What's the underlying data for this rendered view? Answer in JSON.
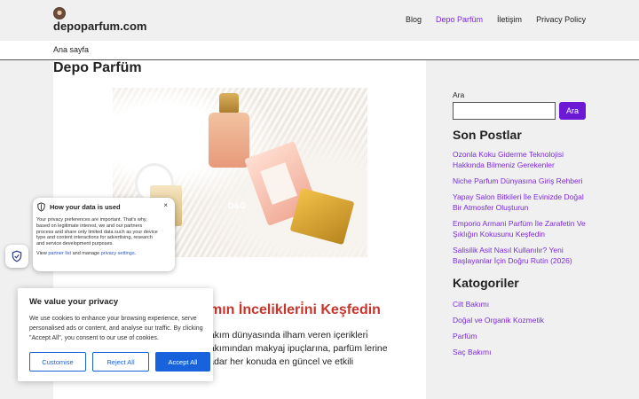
{
  "header": {
    "logo_icon": "perfume-logo-icon",
    "site_title": "depoparfum.com",
    "nav": [
      "Blog",
      "Depo Parfüm",
      "İletişim",
      "Privacy Policy"
    ],
    "active_nav": "Depo Parfüm"
  },
  "breadcrumb": {
    "home": "Ana sayfa"
  },
  "main": {
    "page_title": "Depo Parfüm",
    "hero_image": "perfume-bottles-on-fur",
    "hero_text": "D&G",
    "article_heading": "mın İncelikleri̇ni Keşfedin",
    "excerpt": "bakım dünyasında ilham veren içerikleri̇ bakımından makyaj ipuçlarına, parfüm lerine kadar her konuda en güncel ve etkili"
  },
  "sidebar": {
    "search_label": "Ara",
    "search_placeholder": "",
    "search_button": "Ara",
    "recent_title": "Son Postlar",
    "recent_posts": [
      "Ozonla Koku Giderme Teknolojisi Hakkında Bilmeniz Gerekenler",
      "Niche Parfum Dünyasına Giriş Rehberi",
      "Yapay Salon Bitkileri İle Evinizde Doğal Bir Atmosfer Oluşturun",
      "Emporio Armani Parfüm İle Zarafetin Ve Şıklığın Kokusunu Keşfedin",
      "Salisilik Asit Nasıl Kullanılır? Yeni Başlayanlar İçin Doğru Rutin (2026)"
    ],
    "categories_title": "Katogoriler",
    "categories": [
      "Cilt Bakımı",
      "Doğal ve Organik Kozmetik",
      "Parfüm",
      "Saç Bakımı"
    ]
  },
  "privacy_popup": {
    "title": "How your data is used",
    "close": "×",
    "text": "Your privacy preferences are important. That's why, based on legitimate interest, we and our partners process and share only limited data such as your device type and content interactions for advertising, research and service development purposes.",
    "foot_prefix": "View",
    "partner_link": "partner list",
    "foot_mid": "and manage",
    "settings_link": "privacy settings",
    "foot_suffix": "."
  },
  "cookie": {
    "title": "We value your privacy",
    "text": "We use cookies to enhance your browsing experience, serve personalised ads or content, and analyse our traffic. By clicking \"Accept All\", you consent to our use of cookies.",
    "customise": "Customise",
    "reject": "Reject All",
    "accept": "Accept All",
    "accent": "#1863dc"
  },
  "colors": {
    "accent": "#7b2ae0",
    "button": "#6c19d6",
    "heading_red": "#c9352c"
  }
}
